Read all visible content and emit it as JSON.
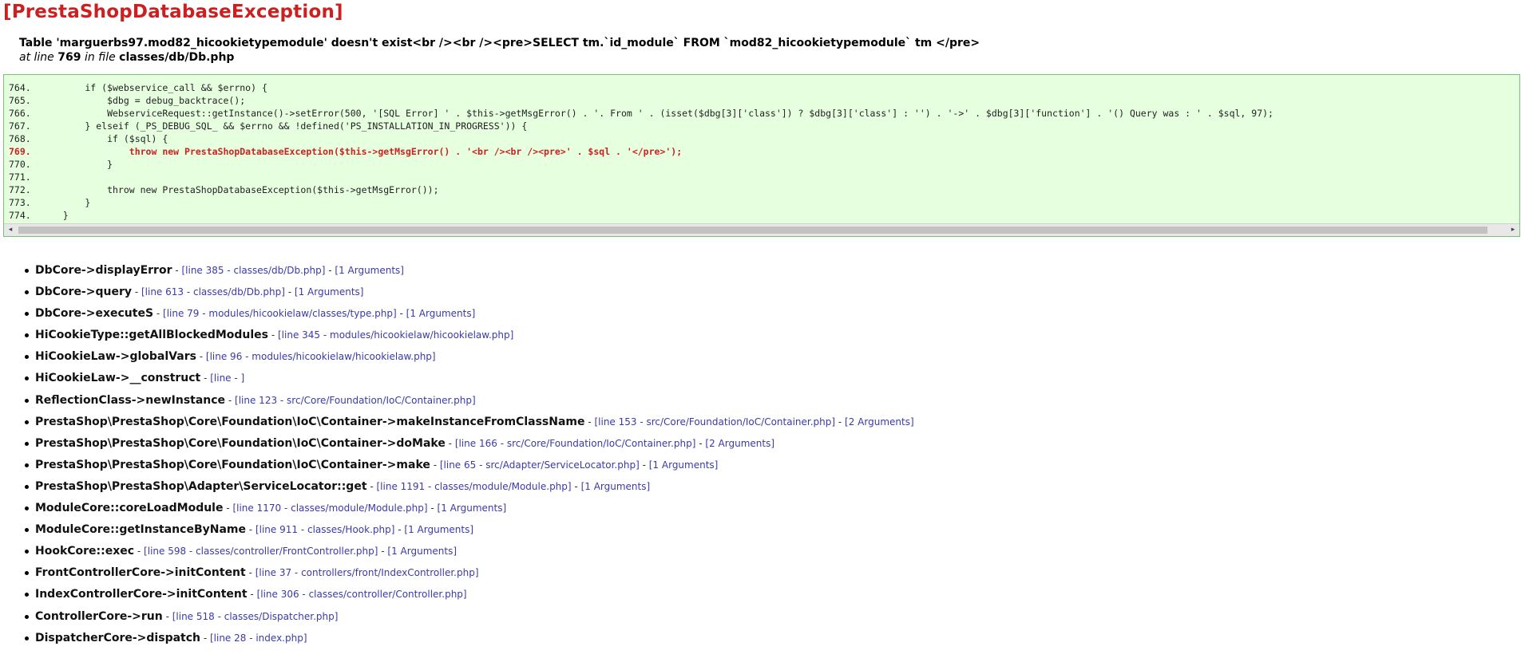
{
  "exception": {
    "title": "[PrestaShopDatabaseException]",
    "message": "Table 'marguerbs97.mod82_hicookietypemodule' doesn't exist<br /><br /><pre>SELECT tm.`id_module` FROM `mod82_hicookietypemodule` tm </pre>",
    "location_prefix": "at line",
    "line_number": "769",
    "location_mid": "in file",
    "file": "classes/db/Db.php"
  },
  "code": {
    "lines": [
      {
        "num": "764.",
        "text": "        if ($webservice_call && $errno) {",
        "highlight": false
      },
      {
        "num": "765.",
        "text": "            $dbg = debug_backtrace();",
        "highlight": false
      },
      {
        "num": "766.",
        "text": "            WebserviceRequest::getInstance()->setError(500, '[SQL Error] ' . $this->getMsgError() . '. From ' . (isset($dbg[3]['class']) ? $dbg[3]['class'] : '') . '->' . $dbg[3]['function'] . '() Query was : ' . $sql, 97);",
        "highlight": false
      },
      {
        "num": "767.",
        "text": "        } elseif (_PS_DEBUG_SQL_ && $errno && !defined('PS_INSTALLATION_IN_PROGRESS')) {",
        "highlight": false
      },
      {
        "num": "768.",
        "text": "            if ($sql) {",
        "highlight": false
      },
      {
        "num": "769.",
        "text": "                throw new PrestaShopDatabaseException($this->getMsgError() . '<br /><br /><pre>' . $sql . '</pre>');",
        "highlight": true
      },
      {
        "num": "770.",
        "text": "            }",
        "highlight": false
      },
      {
        "num": "771.",
        "text": "",
        "highlight": false
      },
      {
        "num": "772.",
        "text": "            throw new PrestaShopDatabaseException($this->getMsgError());",
        "highlight": false
      },
      {
        "num": "773.",
        "text": "        }",
        "highlight": false
      },
      {
        "num": "774.",
        "text": "    }",
        "highlight": false
      }
    ]
  },
  "scrollbar": {
    "left_arrow": "◂",
    "right_arrow": "▸"
  },
  "trace": [
    {
      "fn": "DbCore->displayError",
      "loc": "[line 385 - classes/db/Db.php]",
      "args": "[1 Arguments]"
    },
    {
      "fn": "DbCore->query",
      "loc": "[line 613 - classes/db/Db.php]",
      "args": "[1 Arguments]"
    },
    {
      "fn": "DbCore->executeS",
      "loc": "[line 79 - modules/hicookielaw/classes/type.php]",
      "args": "[1 Arguments]"
    },
    {
      "fn": "HiCookieType::getAllBlockedModules",
      "loc": "[line 345 - modules/hicookielaw/hicookielaw.php]",
      "args": ""
    },
    {
      "fn": "HiCookieLaw->globalVars",
      "loc": "[line 96 - modules/hicookielaw/hicookielaw.php]",
      "args": ""
    },
    {
      "fn": "HiCookieLaw->__construct",
      "loc": "[line - ]",
      "args": ""
    },
    {
      "fn": "ReflectionClass->newInstance",
      "loc": "[line 123 - src/Core/Foundation/IoC/Container.php]",
      "args": ""
    },
    {
      "fn": "PrestaShop\\PrestaShop\\Core\\Foundation\\IoC\\Container->makeInstanceFromClassName",
      "loc": "[line 153 - src/Core/Foundation/IoC/Container.php]",
      "args": "[2 Arguments]"
    },
    {
      "fn": "PrestaShop\\PrestaShop\\Core\\Foundation\\IoC\\Container->doMake",
      "loc": "[line 166 - src/Core/Foundation/IoC/Container.php]",
      "args": "[2 Arguments]"
    },
    {
      "fn": "PrestaShop\\PrestaShop\\Core\\Foundation\\IoC\\Container->make",
      "loc": "[line 65 - src/Adapter/ServiceLocator.php]",
      "args": "[1 Arguments]"
    },
    {
      "fn": "PrestaShop\\PrestaShop\\Adapter\\ServiceLocator::get",
      "loc": "[line 1191 - classes/module/Module.php]",
      "args": "[1 Arguments]"
    },
    {
      "fn": "ModuleCore::coreLoadModule",
      "loc": "[line 1170 - classes/module/Module.php]",
      "args": "[1 Arguments]"
    },
    {
      "fn": "ModuleCore::getInstanceByName",
      "loc": "[line 911 - classes/Hook.php]",
      "args": "[1 Arguments]"
    },
    {
      "fn": "HookCore::exec",
      "loc": "[line 598 - classes/controller/FrontController.php]",
      "args": "[1 Arguments]"
    },
    {
      "fn": "FrontControllerCore->initContent",
      "loc": "[line 37 - controllers/front/IndexController.php]",
      "args": ""
    },
    {
      "fn": "IndexControllerCore->initContent",
      "loc": "[line 306 - classes/controller/Controller.php]",
      "args": ""
    },
    {
      "fn": "ControllerCore->run",
      "loc": "[line 518 - classes/Dispatcher.php]",
      "args": ""
    },
    {
      "fn": "DispatcherCore->dispatch",
      "loc": "[line 28 - index.php]",
      "args": ""
    }
  ]
}
